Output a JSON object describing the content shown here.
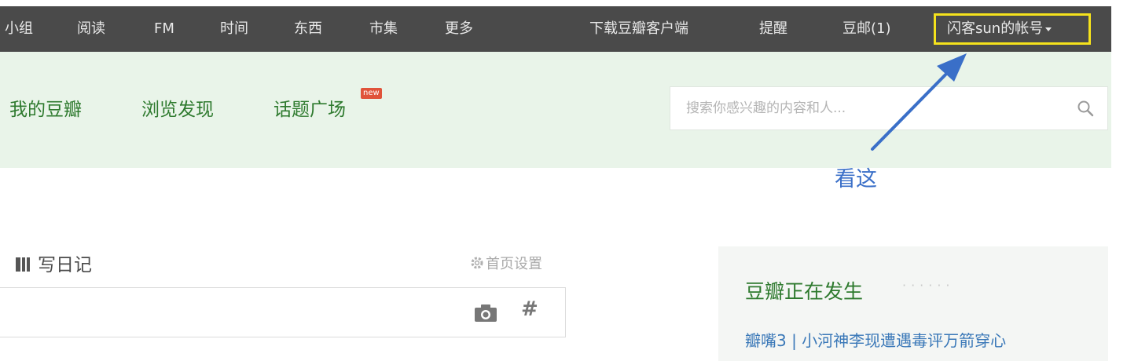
{
  "topnav": {
    "items": [
      "小组",
      "阅读",
      "FM",
      "时间",
      "东西",
      "市集",
      "更多"
    ],
    "right_items": [
      "下载豆瓣客户端",
      "提醒",
      "豆邮(1)"
    ],
    "account_label": "闪客sun的帐号",
    "highlight_color": "#f5e21c"
  },
  "subnav": {
    "items": [
      "我的豆瓣",
      "浏览发现",
      "话题广场"
    ],
    "new_badge": "new"
  },
  "search": {
    "placeholder": "搜索你感兴趣的内容和人..."
  },
  "annotation": {
    "text": "看这",
    "color": "#3a6fc8"
  },
  "main": {
    "write_diary": "写日记",
    "home_settings": "首页设置"
  },
  "sidebar": {
    "title": "豆瓣正在发生",
    "dots": "······",
    "link": "瓣嘴3 | 小河神李现遭遇毒评万箭穿心"
  }
}
